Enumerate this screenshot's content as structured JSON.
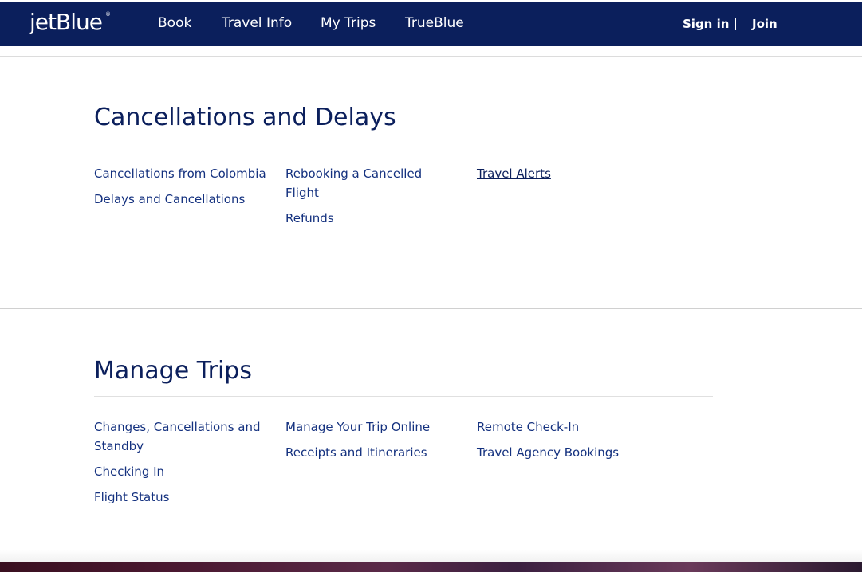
{
  "header": {
    "logo": "jetBlue",
    "logo_mark": "®",
    "nav": [
      "Book",
      "Travel Info",
      "My Trips",
      "TrueBlue"
    ],
    "sign_in": "Sign in",
    "join": "Join"
  },
  "sections": {
    "cancellations": {
      "title": "Cancellations and Delays",
      "col1": [
        "Cancellations from Colombia",
        "Delays and Cancellations"
      ],
      "col2": [
        "Rebooking a Cancelled Flight",
        "Refunds"
      ],
      "col3": [
        "Travel Alerts"
      ]
    },
    "manage": {
      "title": "Manage Trips",
      "col1": [
        "Changes, Cancellations and Standby",
        "Checking In",
        "Flight Status"
      ],
      "col2": [
        "Manage Your Trip Online",
        "Receipts and Itineraries"
      ],
      "col3": [
        "Remote Check-In",
        "Travel Agency Bookings"
      ]
    }
  },
  "colors": {
    "nav_bg": "#0b1f5c",
    "title": "#0b1f5c",
    "link": "#14317f"
  }
}
